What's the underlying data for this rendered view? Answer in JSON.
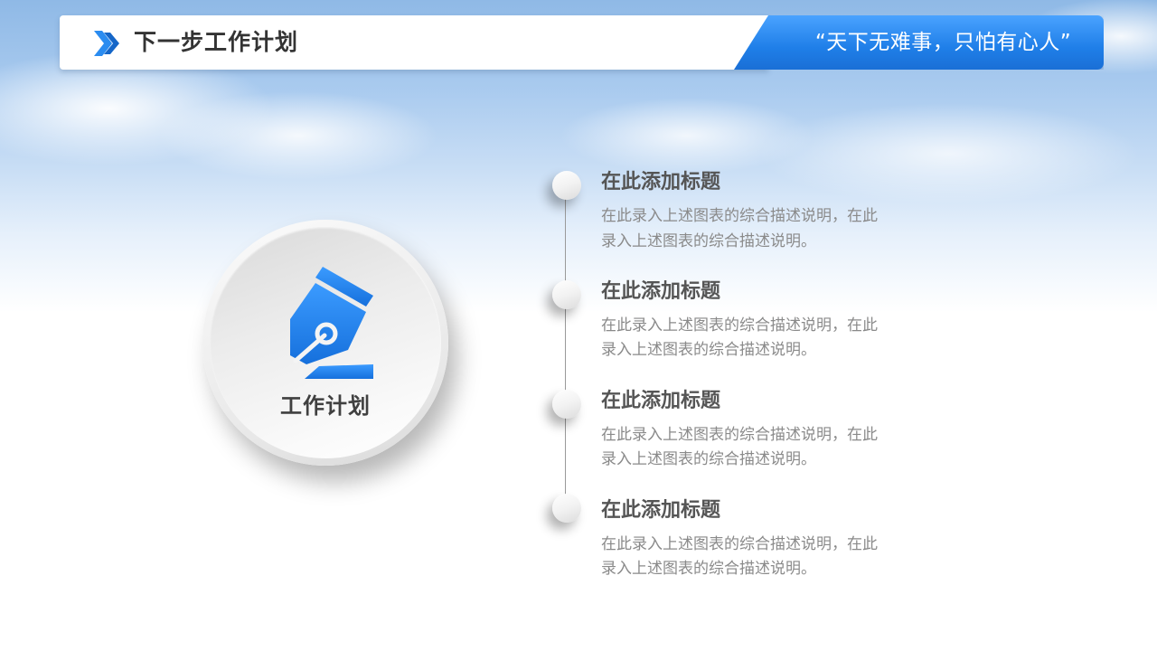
{
  "header": {
    "title": "下一步工作计划",
    "slogan": "“天下无难事，只怕有心人”"
  },
  "center": {
    "label": "工作计划",
    "icon": "fountain-pen-icon",
    "icon_color": "#1f7fe8"
  },
  "colors": {
    "accent": "#1f7fe8",
    "title_text": "#333333",
    "item_title": "#555555",
    "item_desc": "#8a8a8a"
  },
  "items": [
    {
      "title": "在此添加标题",
      "desc_line1": "在此录入上述图表的综合描述说明，在此",
      "desc_line2": "录入上述图表的综合描述说明。"
    },
    {
      "title": "在此添加标题",
      "desc_line1": "在此录入上述图表的综合描述说明，在此",
      "desc_line2": "录入上述图表的综合描述说明。"
    },
    {
      "title": "在此添加标题",
      "desc_line1": "在此录入上述图表的综合描述说明，在此",
      "desc_line2": "录入上述图表的综合描述说明。"
    },
    {
      "title": "在此添加标题",
      "desc_line1": "在此录入上述图表的综合描述说明，在此",
      "desc_line2": "录入上述图表的综合描述说明。"
    }
  ]
}
